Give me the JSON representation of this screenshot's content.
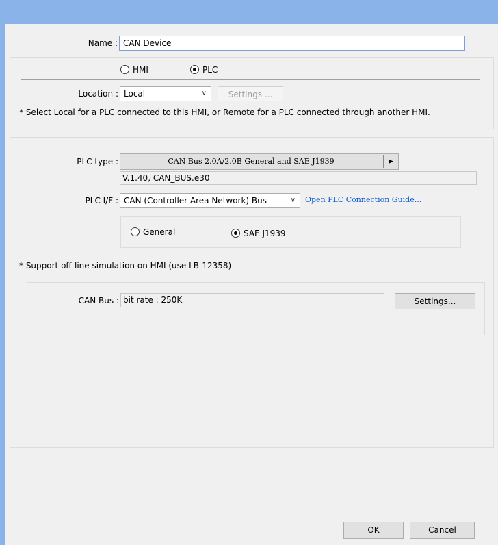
{
  "name": {
    "label": "Name :",
    "value": "CAN Device"
  },
  "device_kind": {
    "hmi_label": "HMI",
    "plc_label": "PLC",
    "selected": "PLC"
  },
  "location": {
    "label": "Location :",
    "value": "Local",
    "settings_label": "Settings ...",
    "note": "* Select Local for a PLC connected to this HMI, or Remote for a PLC connected through another HMI."
  },
  "plc_type": {
    "label": "PLC type :",
    "value": "CAN Bus 2.0A/2.0B General and SAE J1939",
    "version": "V.1.40, CAN_BUS.e30"
  },
  "plc_if": {
    "label": "PLC I/F :",
    "value": "CAN (Controller Area Network) Bus",
    "guide_link": "Open PLC Connection Guide..."
  },
  "protocol": {
    "general_label": "General",
    "sae_label": "SAE J1939",
    "selected": "SAE J1939"
  },
  "simulation_note": "* Support off-line simulation on HMI (use LB-12358)",
  "can_bus": {
    "label": "CAN Bus :",
    "value": "bit rate : 250K",
    "settings_label": "Settings..."
  },
  "footer": {
    "ok_label": "OK",
    "cancel_label": "Cancel"
  }
}
